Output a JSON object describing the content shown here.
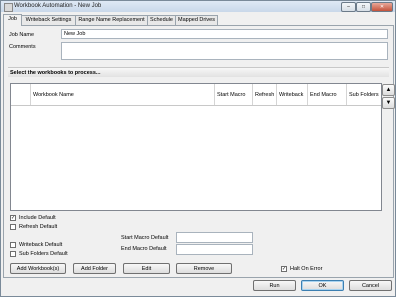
{
  "window": {
    "title": "Workbook Automation - New Job",
    "controls": {
      "minimize": "–",
      "maximize": "□",
      "close": "✕"
    }
  },
  "tabs": [
    {
      "label": "Job",
      "active": true
    },
    {
      "label": "Writeback Settings",
      "active": false
    },
    {
      "label": "Range Name Replacement",
      "active": false
    },
    {
      "label": "Schedule",
      "active": false
    },
    {
      "label": "Mapped Drives",
      "active": false
    }
  ],
  "job": {
    "name_label": "Job Name",
    "name_value": "New Job",
    "comments_label": "Comments",
    "comments_value": ""
  },
  "workbooks": {
    "section_title": "Select the workbooks to process...",
    "columns": [
      "Workbook Name",
      "Start Macro",
      "Refresh",
      "Writeback",
      "End Macro",
      "Sub Folders"
    ],
    "rows": [],
    "move_up_icon": "arrow-up-icon",
    "move_down_icon": "arrow-down-icon"
  },
  "defaults": {
    "include_label": "Include Default",
    "include_checked": true,
    "refresh_label": "Refresh Default",
    "refresh_checked": false,
    "writeback_label": "Writeback Default",
    "writeback_checked": false,
    "subfolders_label": "Sub Folders Default",
    "subfolders_checked": false,
    "start_macro_label": "Start Macro Default",
    "start_macro_value": "",
    "end_macro_label": "End Macro Default",
    "end_macro_value": ""
  },
  "actions": {
    "add_workbooks": "Add Workbook(s)",
    "add_folder": "Add Folder",
    "edit": "Edit",
    "remove": "Remove",
    "halt_on_error_label": "Halt On Error",
    "halt_on_error_checked": true
  },
  "footer": {
    "run": "Run",
    "ok": "OK",
    "cancel": "Cancel"
  }
}
